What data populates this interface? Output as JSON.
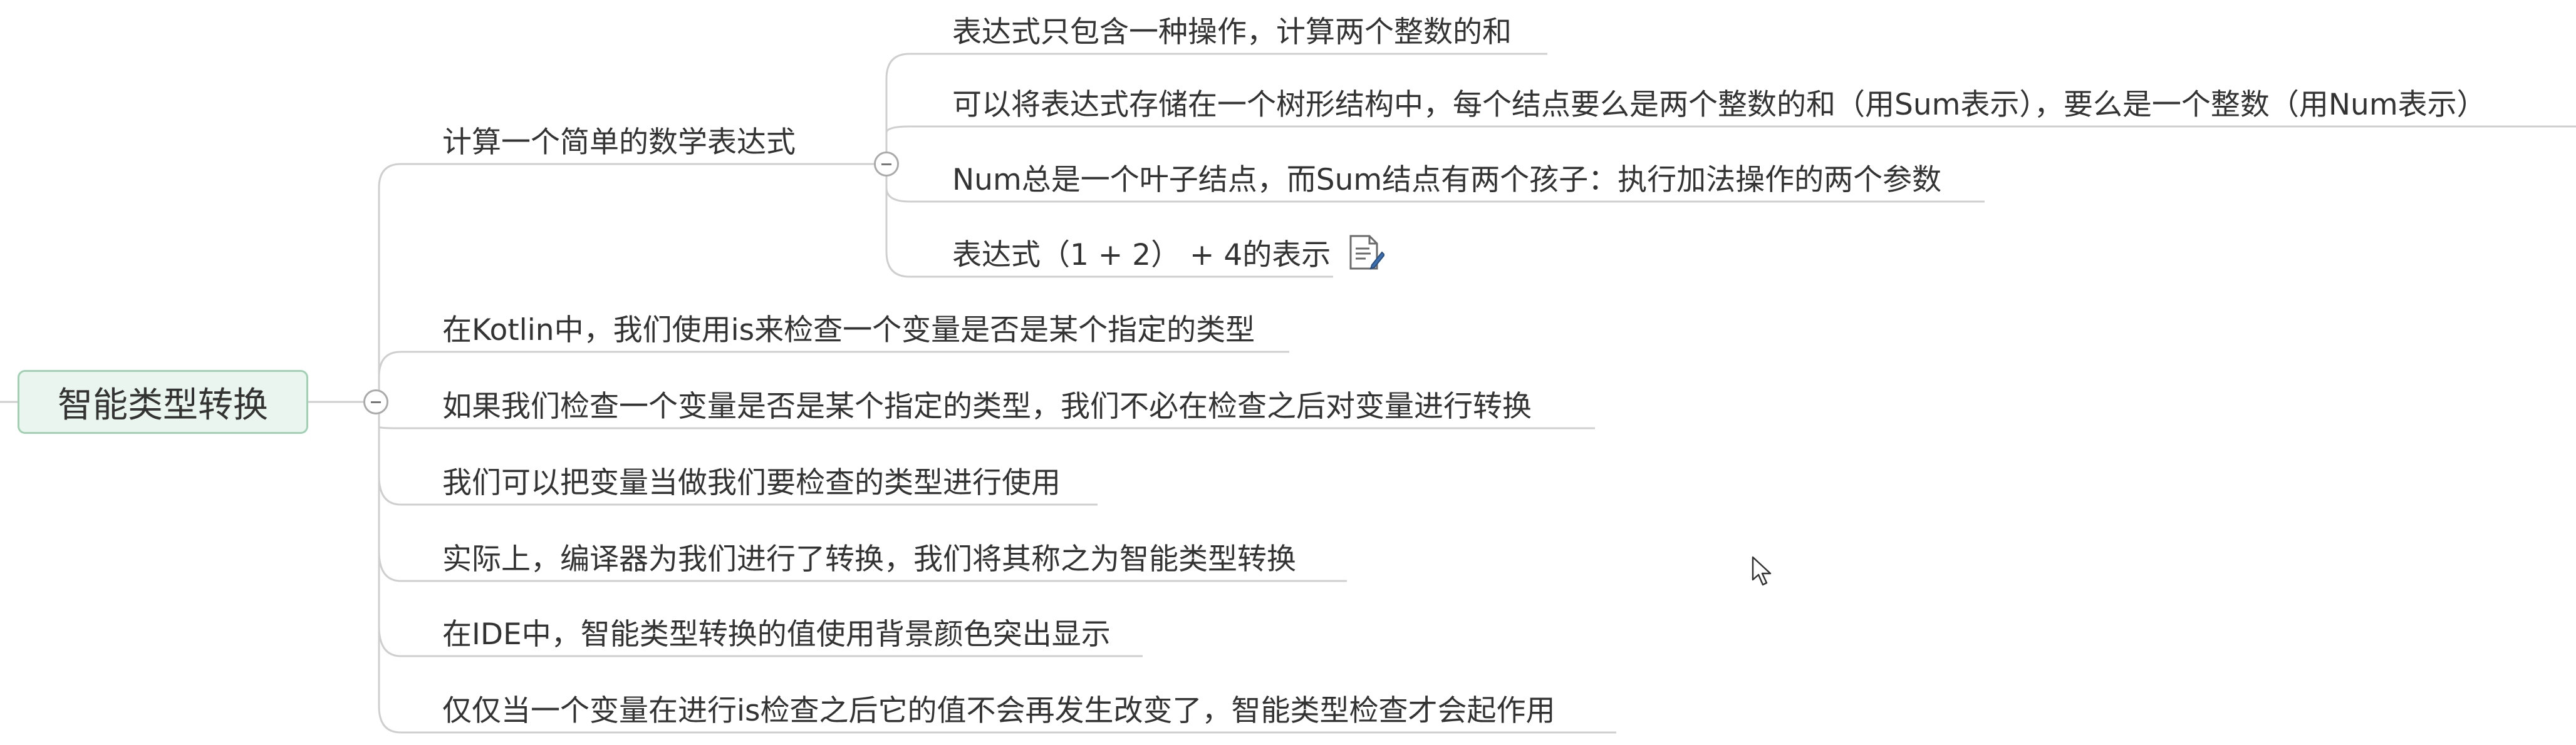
{
  "root": {
    "label": "智能类型转换"
  },
  "branches": [
    {
      "label": "计算一个简单的数学表达式",
      "children": [
        "表达式只包含一种操作，计算两个整数的和",
        "可以将表达式存储在一个树形结构中，每个结点要么是两个整数的和（用Sum表示），要么是一个整数（用Num表示）",
        "Num总是一个叶子结点，而Sum结点有两个孩子：执行加法操作的两个参数",
        "表达式（1 + 2） + 4的表示"
      ]
    },
    {
      "label": "在Kotlin中，我们使用is来检查一个变量是否是某个指定的类型"
    },
    {
      "label": "如果我们检查一个变量是否是某个指定的类型，我们不必在检查之后对变量进行转换"
    },
    {
      "label": "我们可以把变量当做我们要检查的类型进行使用"
    },
    {
      "label": "实际上，编译器为我们进行了转换，我们将其称之为智能类型转换"
    },
    {
      "label": "在IDE中，智能类型转换的值使用背景颜色突出显示"
    },
    {
      "label": "仅仅当一个变量在进行is检查之后它的值不会再发生改变了，智能类型检查才会起作用"
    }
  ],
  "icons": {
    "note": "note-icon",
    "collapse": "collapse-minus-icon",
    "cursor": "mouse-cursor-icon"
  },
  "colors": {
    "line": "#cfcfcf",
    "root_fill": "#e9f5ee",
    "root_border": "#9fd1b2",
    "text": "#333333"
  }
}
